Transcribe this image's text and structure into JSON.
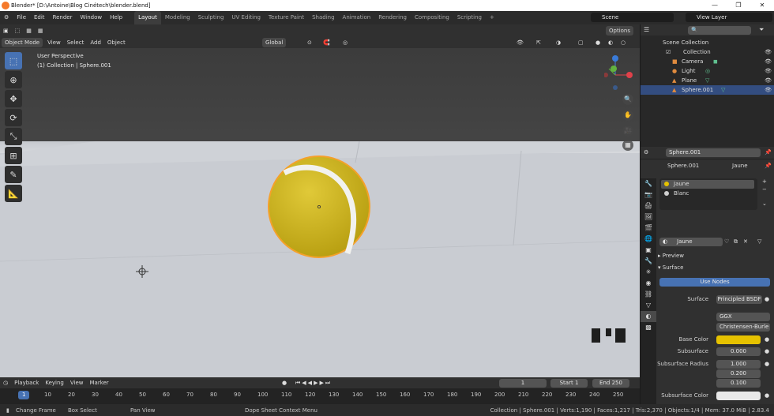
{
  "window": {
    "title": "Blender* [D:\\Antoine\\Blog Cinétech\\blender.blend]"
  },
  "menu": [
    "File",
    "Edit",
    "Render",
    "Window",
    "Help"
  ],
  "workspaces": [
    "Layout",
    "Modeling",
    "Sculpting",
    "UV Editing",
    "Texture Paint",
    "Shading",
    "Animation",
    "Rendering",
    "Compositing",
    "Scripting"
  ],
  "scene": "Scene",
  "view_layer": "View Layer",
  "viewport_header": {
    "mode": "Object Mode",
    "menus": [
      "View",
      "Select",
      "Add",
      "Object"
    ],
    "orientation": "Global",
    "options": "Options"
  },
  "viewport": {
    "perspective": "User Perspective",
    "collection_info": "(1) Collection | Sphere.001"
  },
  "outliner": {
    "root": "Scene Collection",
    "collection": "Collection",
    "items": [
      "Camera",
      "Light",
      "Plane",
      "Sphere.001"
    ]
  },
  "properties": {
    "object_name": "Sphere.001",
    "breadcrumb_object": "Sphere.001",
    "breadcrumb_material": "Jaune",
    "materials": [
      "Jaune",
      "Blanc"
    ],
    "material_field": "Jaune",
    "preview_label": "Preview",
    "surface_label": "Surface",
    "use_nodes": "Use Nodes",
    "surface_field_label": "Surface",
    "surface_shader": "Principled BSDF",
    "distribution": "GGX",
    "subsurface_method": "Christensen-Burle",
    "base_color_label": "Base Color",
    "base_color": "#e6c200",
    "subsurface_label": "Subsurface",
    "subsurface_value": "0.000",
    "subsurface_radius_label": "Subsurface Radius",
    "subsurface_radius": [
      "1.000",
      "0.200",
      "0.100"
    ],
    "subsurface_color_label": "Subsurface Color"
  },
  "timeline": {
    "menus": [
      "Playback",
      "Keying",
      "View",
      "Marker"
    ],
    "current_frame": "1",
    "start_label": "Start",
    "start": "1",
    "end_label": "End",
    "end": "250",
    "ticks": [
      "1",
      "10",
      "20",
      "30",
      "40",
      "50",
      "60",
      "70",
      "80",
      "90",
      "100",
      "110",
      "120",
      "130",
      "140",
      "150",
      "160",
      "170",
      "180",
      "190",
      "200",
      "210",
      "220",
      "230",
      "240",
      "250"
    ]
  },
  "status": {
    "left": "Change Frame",
    "mid1": "Box Select",
    "mid2": "Pan View",
    "mid3": "Dope Sheet Context Menu",
    "right": "Collection | Sphere.001 | Verts:1,190 | Faces:1,217 | Tris:2,370 | Objects:1/4 | Mem: 37.0 MiB | 2.83.4"
  },
  "colors": {
    "accent": "#4772b3",
    "selection": "#334d80",
    "ball": "#d4bb1e",
    "outline_orange": "#f5a02a"
  }
}
